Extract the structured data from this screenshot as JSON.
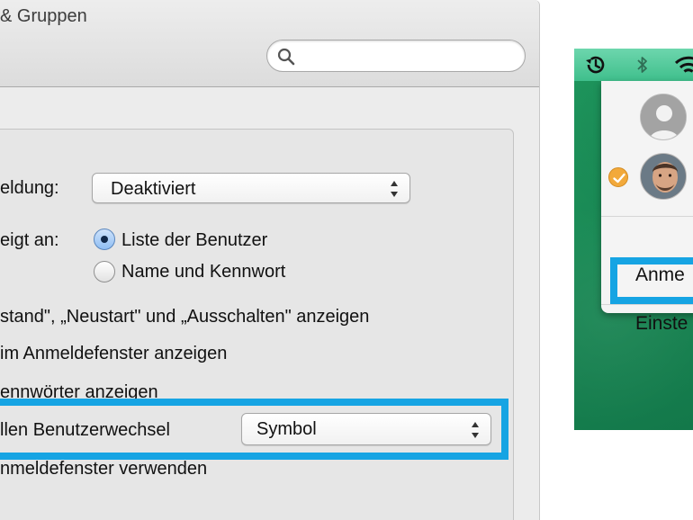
{
  "window": {
    "title": "& Gruppen",
    "search": {
      "placeholder": "",
      "value": ""
    }
  },
  "login_options": {
    "auto_login": {
      "label": "eldung:",
      "value": "Deaktiviert"
    },
    "show_as": {
      "label": "eigt an:",
      "options": [
        {
          "label": "Liste der Benutzer",
          "checked": true
        },
        {
          "label": "Name und Kennwort",
          "checked": false
        }
      ]
    },
    "checkbox_rows": [
      "stand\", „Neustart\" und „Ausschalten\" anzeigen",
      "im Anmeldefenster anzeigen",
      "ennwörter anzeigen"
    ],
    "fast_user_switching": {
      "label": "llen Benutzerwechsel",
      "value": "Symbol"
    },
    "last_row": "nmeldefenster verwenden"
  },
  "menubar": {
    "icons": [
      "time-machine-icon",
      "bluetooth-icon",
      "wifi-icon"
    ],
    "menu": {
      "users": [
        {
          "type": "guest",
          "checked": false
        },
        {
          "type": "current-user",
          "checked": true
        }
      ],
      "items": [
        "Anme",
        "Einste"
      ]
    }
  },
  "colors": {
    "highlight": "#16a4e3",
    "menubar": "#4fc898",
    "desktop": "#1b8a55",
    "check_badge": "#f2a93b"
  }
}
